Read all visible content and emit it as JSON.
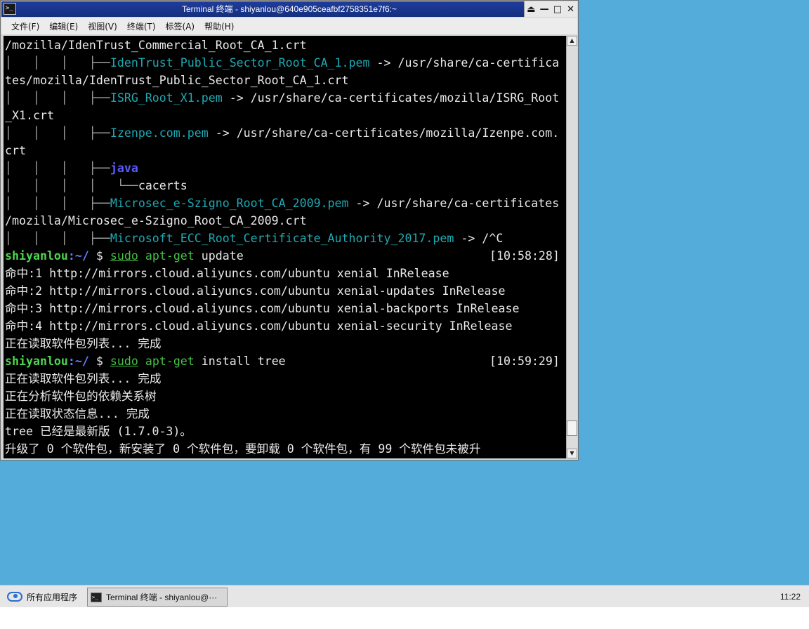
{
  "window": {
    "title": "Terminal 终端 - shiyanlou@640e905ceafbf2758351e7f6:~",
    "controls": [
      "⏏",
      "—",
      "□",
      "✕"
    ]
  },
  "menu": [
    "文件(F)",
    "编辑(E)",
    "视图(V)",
    "终端(T)",
    "标签(A)",
    "帮助(H)"
  ],
  "terminal": {
    "l01": "/mozilla/IdenTrust_Commercial_Root_CA_1.crt",
    "l02_tree": "│   │   │   ├──",
    "l02_file": "IdenTrust_Public_Sector_Root_CA_1.pem",
    "l02_rest": " -> /usr/share/ca-certifica",
    "l03": "tes/mozilla/IdenTrust_Public_Sector_Root_CA_1.crt",
    "l04_tree": "│   │   │   ├──",
    "l04_file": "ISRG_Root_X1.pem",
    "l04_rest": " -> /usr/share/ca-certificates/mozilla/ISRG_Root",
    "l05": "_X1.crt",
    "l06_tree": "│   │   │   ├──",
    "l06_file": "Izenpe.com.pem",
    "l06_rest": " -> /usr/share/ca-certificates/mozilla/Izenpe.com.",
    "l07": "crt",
    "l08_tree": "│   │   │   ├──",
    "l08_dir": "java",
    "l09_tree": "│   │   │   │   └──",
    "l09_text": "cacerts",
    "l10_tree": "│   │   │   ├──",
    "l10_file": "Microsec_e-Szigno_Root_CA_2009.pem",
    "l10_rest": " -> /usr/share/ca-certificates",
    "l11": "/mozilla/Microsec_e-Szigno_Root_CA_2009.crt",
    "l12_tree": "│   │   │   ├──",
    "l12_file": "Microsoft_ECC_Root_Certificate_Authority_2017.pem",
    "l12_rest": " -> /^C",
    "prompt_user": "shiyanlou",
    "prompt_path": ":~/",
    "prompt_dollar": " $ ",
    "cmd1_sudo": "sudo",
    "cmd1_bin": "apt-get",
    "cmd1_args": " update",
    "cmd1_time": "[10:58:28]",
    "h1": "命中:1 http://mirrors.cloud.aliyuncs.com/ubuntu xenial InRelease",
    "h2": "命中:2 http://mirrors.cloud.aliyuncs.com/ubuntu xenial-updates InRelease",
    "h3": "命中:3 http://mirrors.cloud.aliyuncs.com/ubuntu xenial-backports InRelease",
    "h4": "命中:4 http://mirrors.cloud.aliyuncs.com/ubuntu xenial-security InRelease",
    "r1": "正在读取软件包列表... 完成",
    "cmd2_args": " install tree",
    "cmd2_time": "[10:59:29]",
    "r2": "正在读取软件包列表... 完成",
    "r3": "正在分析软件包的依赖关系树",
    "r4": "正在读取状态信息... 完成",
    "r5": "tree 已经是最新版 (1.7.0-3)。",
    "r6": "升级了 0 个软件包，新安装了 0 个软件包，要卸载 0 个软件包，有 99 个软件包未被升"
  },
  "taskbar": {
    "start_label": "所有应用程序",
    "task_label": "Terminal 终端 - shiyanlou@···",
    "clock": "11:22"
  }
}
